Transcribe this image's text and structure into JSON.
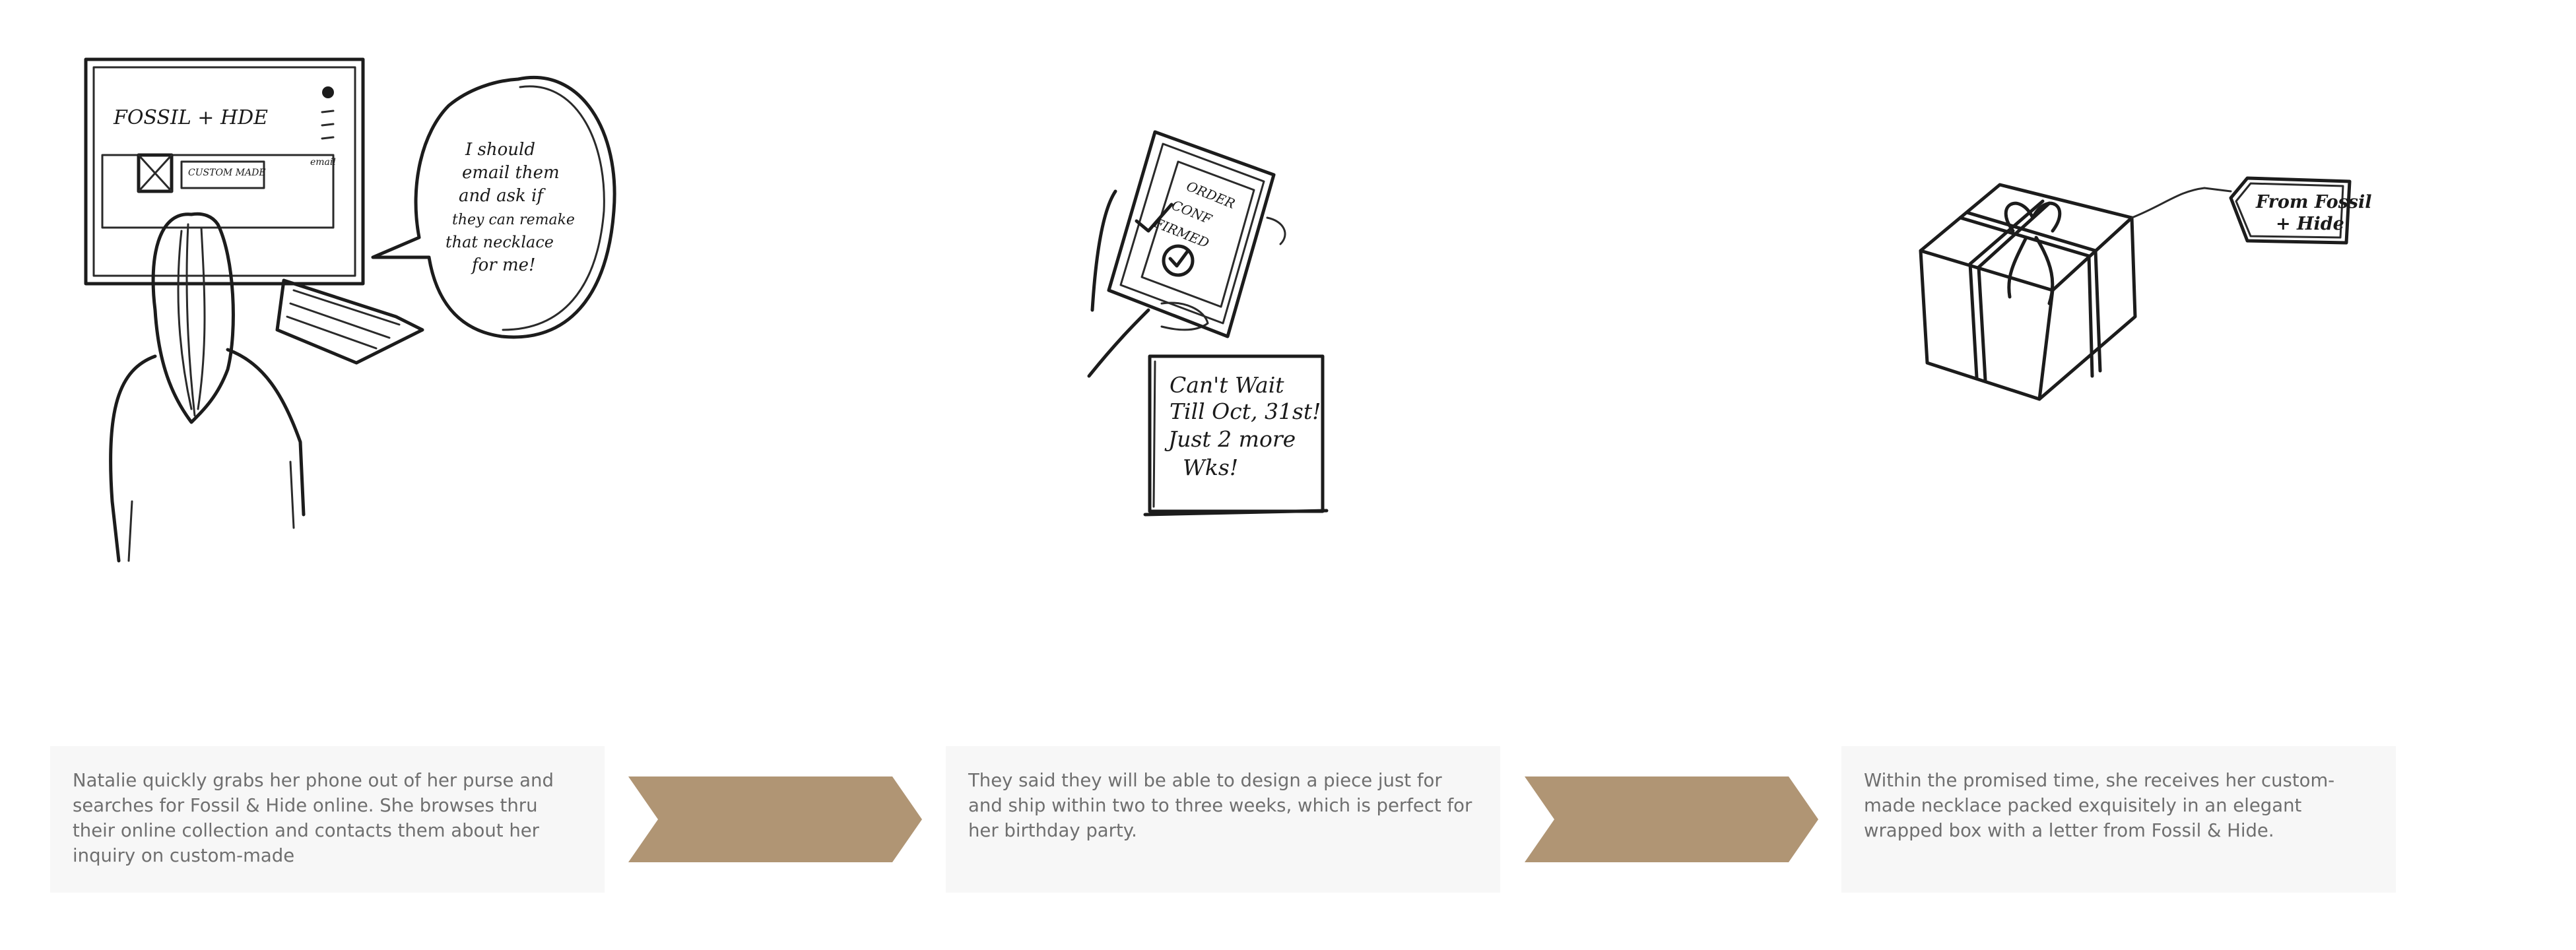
{
  "panels": [
    {
      "brand": "FOSSIL + HDE",
      "button": "CUSTOM MADE",
      "email": "email",
      "speech": [
        "I should",
        "email them",
        "and ask if",
        "they can remake",
        "that necklace",
        "for me!"
      ]
    },
    {
      "phone_screen": [
        "ORDER",
        "CONF",
        "FIRMED"
      ],
      "note": [
        "Can't Wait",
        "Till Oct, 31st!",
        "Just 2 more",
        "Wks!"
      ]
    },
    {
      "tag": [
        "From Fossil",
        "+ Hide"
      ]
    }
  ],
  "captions": [
    "Natalie quickly grabs her phone out of her purse and searches for Fossil & Hide online. She browses thru their online collection and contacts them about her inquiry on custom-made",
    "They said they will be able to design a piece just for and ship within two to three weeks, which is perfect for her birthday party.",
    "Within the promised time, she receives her custom-made necklace packed exquisitely in an elegant wrapped box with a letter from Fossil & Hide."
  ],
  "colors": {
    "arrow": "#b09574",
    "card": "#f7f7f7",
    "caption_text": "#6f6f6f",
    "ink": "#1c1c1c"
  }
}
